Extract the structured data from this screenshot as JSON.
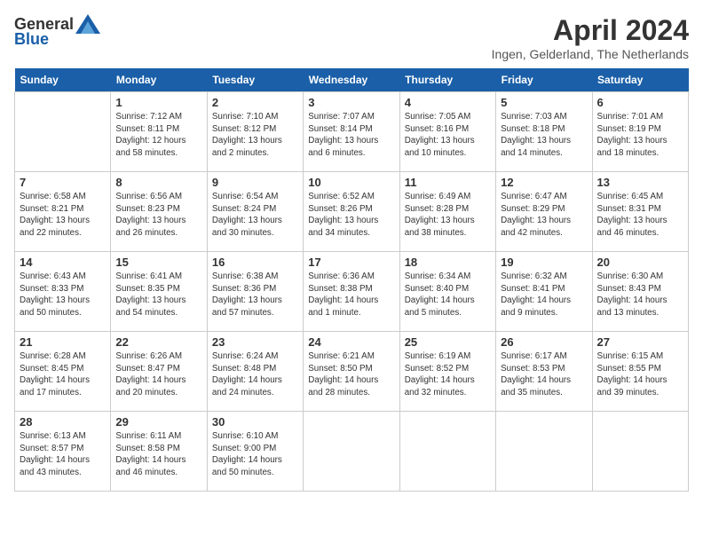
{
  "logo": {
    "general": "General",
    "blue": "Blue"
  },
  "title": "April 2024",
  "location": "Ingen, Gelderland, The Netherlands",
  "weekdays": [
    "Sunday",
    "Monday",
    "Tuesday",
    "Wednesday",
    "Thursday",
    "Friday",
    "Saturday"
  ],
  "weeks": [
    [
      {
        "day": "",
        "info": ""
      },
      {
        "day": "1",
        "info": "Sunrise: 7:12 AM\nSunset: 8:11 PM\nDaylight: 12 hours\nand 58 minutes."
      },
      {
        "day": "2",
        "info": "Sunrise: 7:10 AM\nSunset: 8:12 PM\nDaylight: 13 hours\nand 2 minutes."
      },
      {
        "day": "3",
        "info": "Sunrise: 7:07 AM\nSunset: 8:14 PM\nDaylight: 13 hours\nand 6 minutes."
      },
      {
        "day": "4",
        "info": "Sunrise: 7:05 AM\nSunset: 8:16 PM\nDaylight: 13 hours\nand 10 minutes."
      },
      {
        "day": "5",
        "info": "Sunrise: 7:03 AM\nSunset: 8:18 PM\nDaylight: 13 hours\nand 14 minutes."
      },
      {
        "day": "6",
        "info": "Sunrise: 7:01 AM\nSunset: 8:19 PM\nDaylight: 13 hours\nand 18 minutes."
      }
    ],
    [
      {
        "day": "7",
        "info": "Sunrise: 6:58 AM\nSunset: 8:21 PM\nDaylight: 13 hours\nand 22 minutes."
      },
      {
        "day": "8",
        "info": "Sunrise: 6:56 AM\nSunset: 8:23 PM\nDaylight: 13 hours\nand 26 minutes."
      },
      {
        "day": "9",
        "info": "Sunrise: 6:54 AM\nSunset: 8:24 PM\nDaylight: 13 hours\nand 30 minutes."
      },
      {
        "day": "10",
        "info": "Sunrise: 6:52 AM\nSunset: 8:26 PM\nDaylight: 13 hours\nand 34 minutes."
      },
      {
        "day": "11",
        "info": "Sunrise: 6:49 AM\nSunset: 8:28 PM\nDaylight: 13 hours\nand 38 minutes."
      },
      {
        "day": "12",
        "info": "Sunrise: 6:47 AM\nSunset: 8:29 PM\nDaylight: 13 hours\nand 42 minutes."
      },
      {
        "day": "13",
        "info": "Sunrise: 6:45 AM\nSunset: 8:31 PM\nDaylight: 13 hours\nand 46 minutes."
      }
    ],
    [
      {
        "day": "14",
        "info": "Sunrise: 6:43 AM\nSunset: 8:33 PM\nDaylight: 13 hours\nand 50 minutes."
      },
      {
        "day": "15",
        "info": "Sunrise: 6:41 AM\nSunset: 8:35 PM\nDaylight: 13 hours\nand 54 minutes."
      },
      {
        "day": "16",
        "info": "Sunrise: 6:38 AM\nSunset: 8:36 PM\nDaylight: 13 hours\nand 57 minutes."
      },
      {
        "day": "17",
        "info": "Sunrise: 6:36 AM\nSunset: 8:38 PM\nDaylight: 14 hours\nand 1 minute."
      },
      {
        "day": "18",
        "info": "Sunrise: 6:34 AM\nSunset: 8:40 PM\nDaylight: 14 hours\nand 5 minutes."
      },
      {
        "day": "19",
        "info": "Sunrise: 6:32 AM\nSunset: 8:41 PM\nDaylight: 14 hours\nand 9 minutes."
      },
      {
        "day": "20",
        "info": "Sunrise: 6:30 AM\nSunset: 8:43 PM\nDaylight: 14 hours\nand 13 minutes."
      }
    ],
    [
      {
        "day": "21",
        "info": "Sunrise: 6:28 AM\nSunset: 8:45 PM\nDaylight: 14 hours\nand 17 minutes."
      },
      {
        "day": "22",
        "info": "Sunrise: 6:26 AM\nSunset: 8:47 PM\nDaylight: 14 hours\nand 20 minutes."
      },
      {
        "day": "23",
        "info": "Sunrise: 6:24 AM\nSunset: 8:48 PM\nDaylight: 14 hours\nand 24 minutes."
      },
      {
        "day": "24",
        "info": "Sunrise: 6:21 AM\nSunset: 8:50 PM\nDaylight: 14 hours\nand 28 minutes."
      },
      {
        "day": "25",
        "info": "Sunrise: 6:19 AM\nSunset: 8:52 PM\nDaylight: 14 hours\nand 32 minutes."
      },
      {
        "day": "26",
        "info": "Sunrise: 6:17 AM\nSunset: 8:53 PM\nDaylight: 14 hours\nand 35 minutes."
      },
      {
        "day": "27",
        "info": "Sunrise: 6:15 AM\nSunset: 8:55 PM\nDaylight: 14 hours\nand 39 minutes."
      }
    ],
    [
      {
        "day": "28",
        "info": "Sunrise: 6:13 AM\nSunset: 8:57 PM\nDaylight: 14 hours\nand 43 minutes."
      },
      {
        "day": "29",
        "info": "Sunrise: 6:11 AM\nSunset: 8:58 PM\nDaylight: 14 hours\nand 46 minutes."
      },
      {
        "day": "30",
        "info": "Sunrise: 6:10 AM\nSunset: 9:00 PM\nDaylight: 14 hours\nand 50 minutes."
      },
      {
        "day": "",
        "info": ""
      },
      {
        "day": "",
        "info": ""
      },
      {
        "day": "",
        "info": ""
      },
      {
        "day": "",
        "info": ""
      }
    ]
  ]
}
